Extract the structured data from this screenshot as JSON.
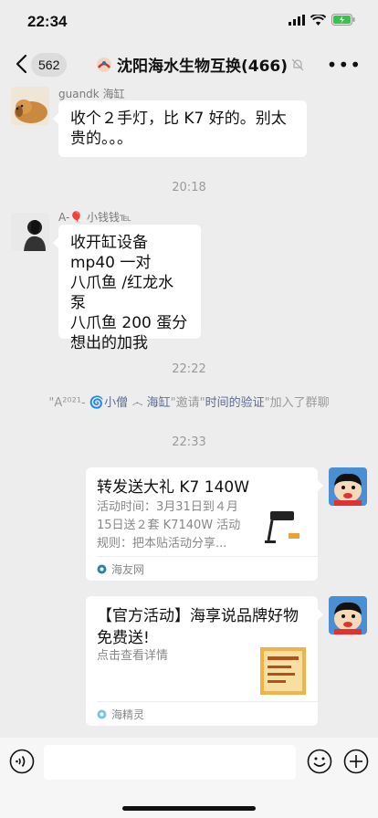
{
  "status": {
    "time": "22:34"
  },
  "nav": {
    "unread": "562",
    "title": "沈阳海水生物互换(466)"
  },
  "messages": [
    {
      "sender": "guandk 海缸",
      "text": "收个２手灯，比 K7 好的。别太贵的。。。"
    },
    {
      "sender": "A-🎈 小钱钱℡",
      "text": "收开缸设备\nmp40 一对\n八爪鱼 /红龙水泵\n八爪鱼 200 蛋分\n想出的加我"
    }
  ],
  "timestamps": [
    "20:18",
    "22:22",
    "22:33"
  ],
  "system": {
    "p1": "\"A²⁰²¹- ",
    "name1": "🌀小僧 ෴ 海缸",
    "p2": "\"邀请\"",
    "name2": "时间的验证",
    "p3": "\"加入了群聊"
  },
  "cards": [
    {
      "title": "转发送大礼 K7 140W",
      "desc": "活动时间：3月31日到４月15日送２套 K7140W 活动规则：把本贴活动分享...",
      "source": "海友网"
    },
    {
      "title": "【官方活动】海享说品牌好物免费送!",
      "desc": "点击查看详情",
      "source": "海精灵"
    }
  ],
  "colors": {
    "background": "#ededed",
    "bubble": "#ffffff",
    "system_link": "#5b6b93"
  }
}
